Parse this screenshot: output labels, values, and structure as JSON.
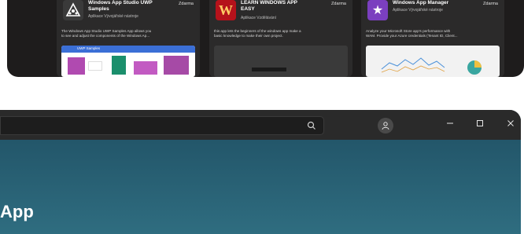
{
  "cards": [
    {
      "title_line1": "Windows App Studio UWP",
      "title_line2": "Samples",
      "price": "Zdarma",
      "category": "Aplikace  Vývojářské nástroje",
      "desc_line1": "The Windows App Studio UWP Samples App allows you",
      "desc_line2": "to see and adjust the components of the Windows Ap...",
      "logo_icon": "triangle-people-icon",
      "screenshot_label": "UWP Samples"
    },
    {
      "title_line1": "LEARN WINDOWS APP",
      "title_line2": "EASY",
      "price": "Zdarma",
      "category": "Aplikace  Vzdělávání",
      "desc_line1": "this app lets the beginners of the windows app make a",
      "desc_line2": "basic knowledge to make their own project.",
      "logo_icon": "w-letter-icon"
    },
    {
      "title_line1": "Windows App Manager",
      "title_line2": "",
      "price": "Zdarma",
      "category": "Aplikace  Vývojářské nástroje",
      "desc_line1": "Analyze your Microsoft Store app's performance with",
      "desc_line2": "WAM. Provide your Azure credentials (Tenant ID, Client...",
      "logo_icon": "star-icon"
    }
  ],
  "window": {
    "title_text": "App",
    "search_icon": "search-icon",
    "avatar_icon": "user-icon",
    "minimize_icon": "minimize-icon",
    "maximize_icon": "maximize-icon",
    "close_icon": "close-icon"
  },
  "colors": {
    "panel_bg": "#1e1c1c",
    "card_bg": "#2b2a2a",
    "window_gradient_top": "#1f4f63",
    "window_gradient_bottom": "#2f6d80",
    "accent_purple": "#7b3fbf",
    "accent_red": "#b5121b"
  }
}
